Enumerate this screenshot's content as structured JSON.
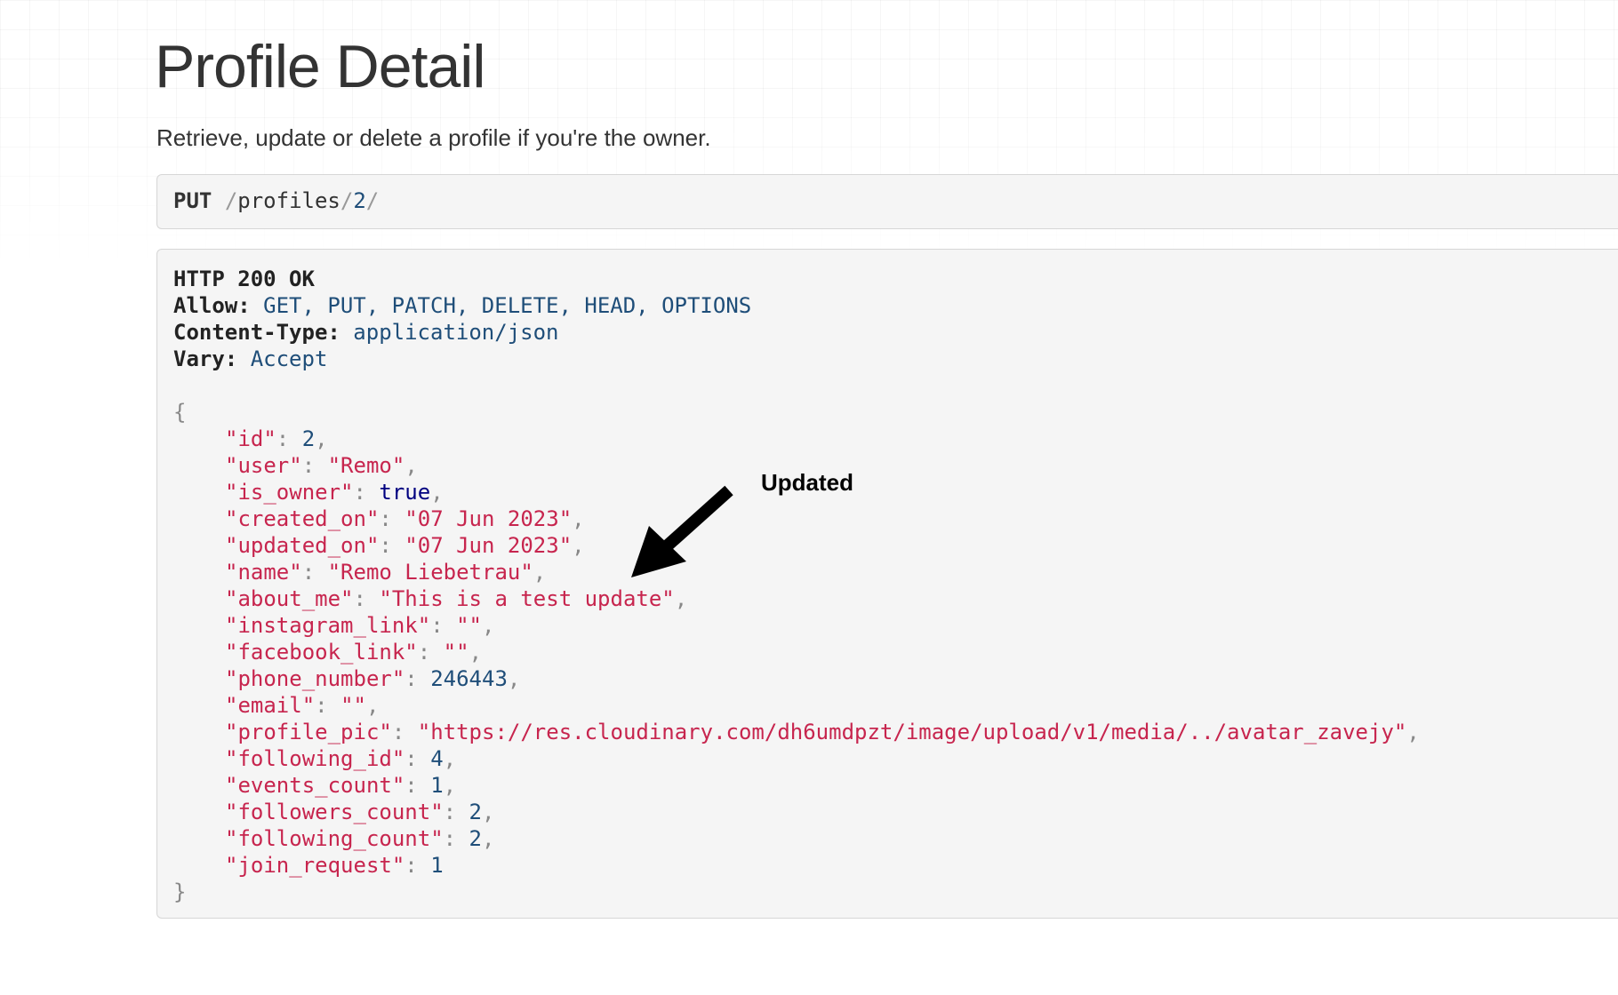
{
  "page": {
    "title": "Profile Detail",
    "description": "Retrieve, update or delete a profile if you're the owner."
  },
  "request": {
    "method": "PUT",
    "path_segments": [
      "profiles",
      "2"
    ]
  },
  "response": {
    "status_line": "HTTP 200 OK",
    "headers": [
      {
        "key": "Allow:",
        "value": "GET, PUT, PATCH, DELETE, HEAD, OPTIONS"
      },
      {
        "key": "Content-Type:",
        "value": "application/json"
      },
      {
        "key": "Vary:",
        "value": "Accept"
      }
    ],
    "open_brace": "{",
    "close_brace": "}",
    "body": [
      {
        "key": "\"id\"",
        "value": "2",
        "type": "num",
        "comma": true
      },
      {
        "key": "\"user\"",
        "value": "\"Remo\"",
        "type": "str",
        "comma": true
      },
      {
        "key": "\"is_owner\"",
        "value": "true",
        "type": "bool",
        "comma": true
      },
      {
        "key": "\"created_on\"",
        "value": "\"07 Jun 2023\"",
        "type": "str",
        "comma": true
      },
      {
        "key": "\"updated_on\"",
        "value": "\"07 Jun 2023\"",
        "type": "str",
        "comma": true
      },
      {
        "key": "\"name\"",
        "value": "\"Remo Liebetrau\"",
        "type": "str",
        "comma": true
      },
      {
        "key": "\"about_me\"",
        "value": "\"This is a test update\"",
        "type": "str",
        "comma": true
      },
      {
        "key": "\"instagram_link\"",
        "value": "\"\"",
        "type": "str",
        "comma": true
      },
      {
        "key": "\"facebook_link\"",
        "value": "\"\"",
        "type": "str",
        "comma": true
      },
      {
        "key": "\"phone_number\"",
        "value": "246443",
        "type": "num",
        "comma": true
      },
      {
        "key": "\"email\"",
        "value": "\"\"",
        "type": "str",
        "comma": true
      },
      {
        "key": "\"profile_pic\"",
        "value": "\"https://res.cloudinary.com/dh6umdpzt/image/upload/v1/media/../avatar_zavejy\"",
        "type": "str",
        "comma": true
      },
      {
        "key": "\"following_id\"",
        "value": "4",
        "type": "num",
        "comma": true
      },
      {
        "key": "\"events_count\"",
        "value": "1",
        "type": "num",
        "comma": true
      },
      {
        "key": "\"followers_count\"",
        "value": "2",
        "type": "num",
        "comma": true
      },
      {
        "key": "\"following_count\"",
        "value": "2",
        "type": "num",
        "comma": true
      },
      {
        "key": "\"join_request\"",
        "value": "1",
        "type": "num",
        "comma": false
      }
    ]
  },
  "annotation": {
    "label": "Updated",
    "icon": "arrow-icon"
  },
  "colors": {
    "json_key": "#c7254e",
    "json_number": "#1f4e79",
    "json_bool": "#000080",
    "header_value": "#1f4e79",
    "box_background": "#f5f5f5"
  }
}
